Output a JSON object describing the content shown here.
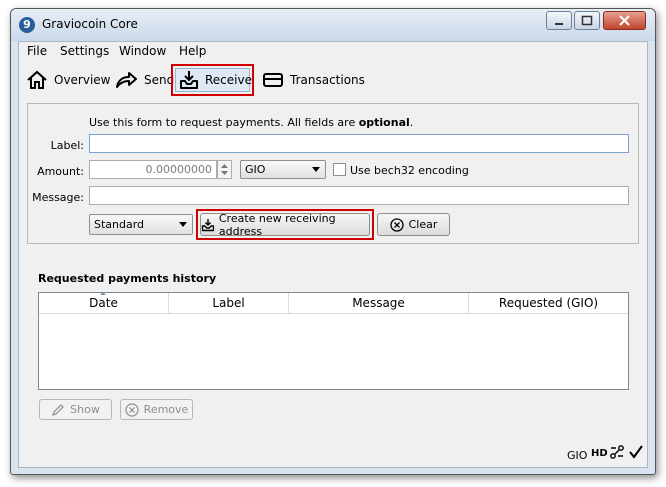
{
  "window": {
    "title": "Graviocoin Core",
    "icon_glyph": "9"
  },
  "menu": [
    "File",
    "Settings",
    "Window",
    "Help"
  ],
  "toolbar": {
    "overview": "Overview",
    "send": "Send",
    "receive": "Receive",
    "transactions": "Transactions"
  },
  "form": {
    "intro_prefix": "Use this form to request payments. All fields are ",
    "intro_bold": "optional",
    "intro_suffix": ".",
    "label_label": "Label:",
    "amount_label": "Amount:",
    "amount_value": "0.00000000",
    "unit": "GIO",
    "bech32_label": "Use bech32 encoding",
    "message_label": "Message:",
    "address_type": "Standard",
    "create_button": "Create new receiving address",
    "clear_button": "Clear"
  },
  "history": {
    "title": "Requested payments history",
    "columns": [
      "Date",
      "Label",
      "Message",
      "Requested (GIO)"
    ],
    "show_button": "Show",
    "remove_button": "Remove"
  },
  "statusbar": {
    "unit": "GIO",
    "hd": "HD"
  },
  "colors": {
    "highlight": "#d10000",
    "accent": "#2a5e9a"
  }
}
